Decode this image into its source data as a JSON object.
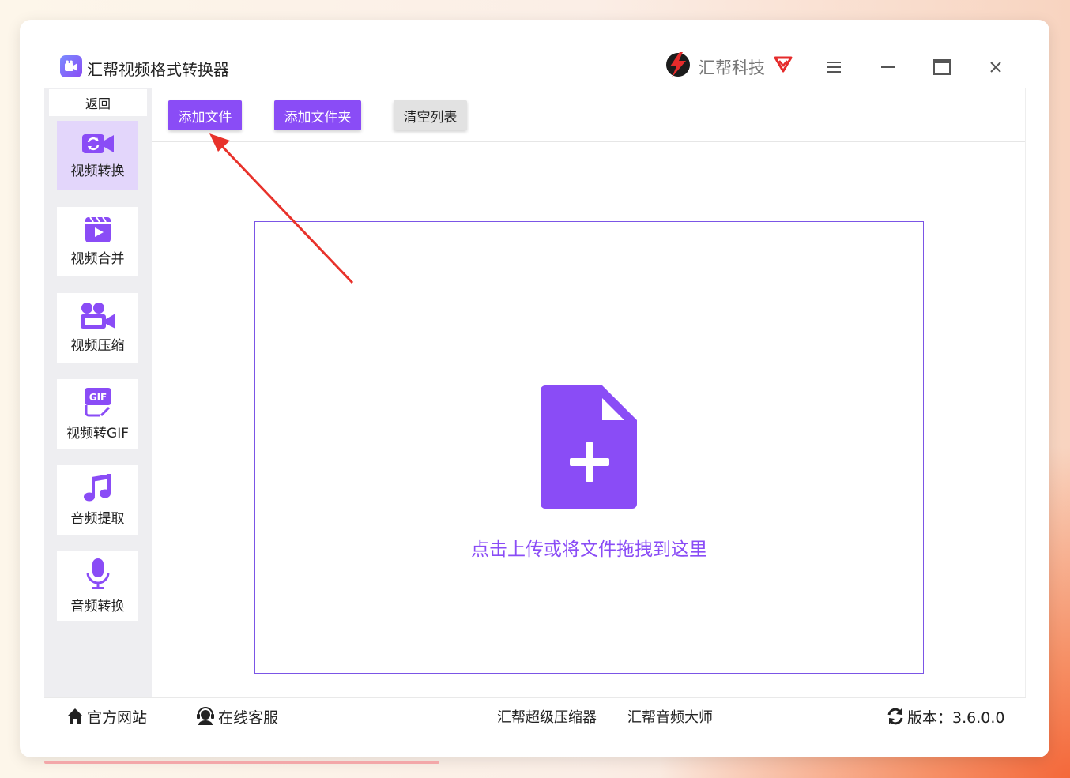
{
  "window": {
    "title": "汇帮视频格式转换器",
    "brand": "汇帮科技"
  },
  "sidebar": {
    "back_label": "返回",
    "items": [
      {
        "label": "视频转换",
        "icon": "video-convert-icon",
        "active": true
      },
      {
        "label": "视频合并",
        "icon": "video-merge-icon"
      },
      {
        "label": "视频压缩",
        "icon": "video-compress-icon"
      },
      {
        "label": "视频转GIF",
        "icon": "gif-icon"
      },
      {
        "label": "音频提取",
        "icon": "music-note-icon"
      },
      {
        "label": "音频转换",
        "icon": "microphone-icon"
      }
    ]
  },
  "toolbar": {
    "add_file": "添加文件",
    "add_folder": "添加文件夹",
    "clear_list": "清空列表"
  },
  "dropzone": {
    "text": "点击上传或将文件拖拽到这里"
  },
  "footer": {
    "website": "官方网站",
    "support": "在线客服",
    "compressor": "汇帮超级压缩器",
    "audio_master": "汇帮音频大师",
    "version": "版本：3.6.0.0"
  },
  "colors": {
    "accent": "#8a4cf6",
    "active_item_bg": "#e3d6fb",
    "annotation_arrow": "#e8322b"
  }
}
